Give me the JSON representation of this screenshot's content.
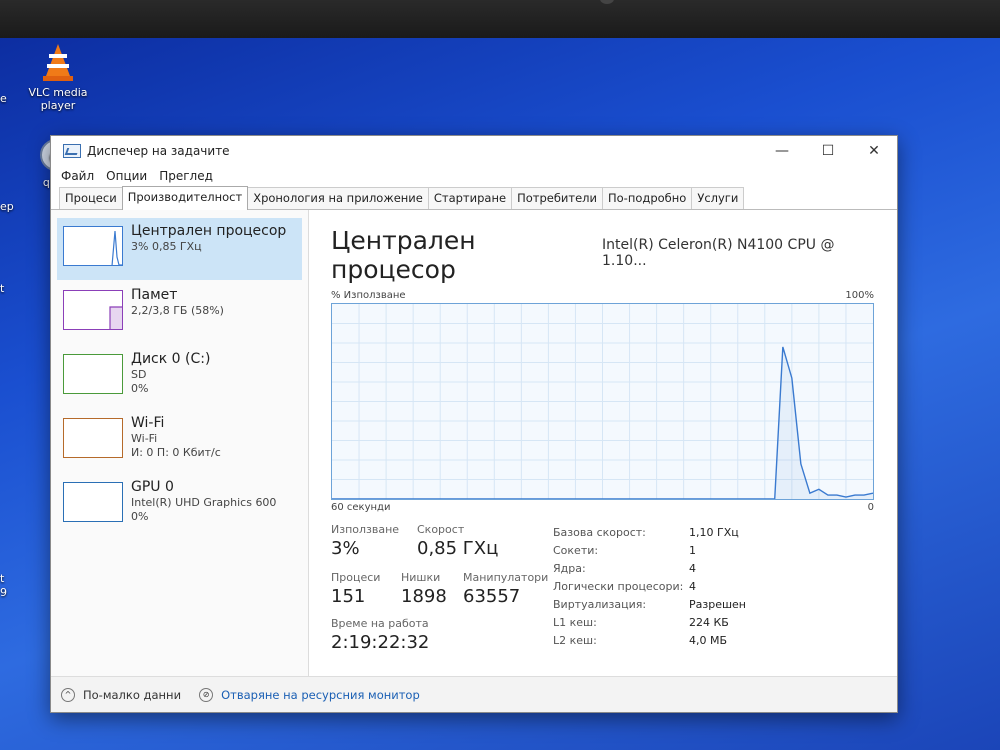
{
  "desktop": {
    "vlc_label": "VLC media player",
    "qbit_label": "qBitt",
    "left_fragments": [
      "е",
      "ер",
      "t",
      "t",
      "9"
    ]
  },
  "window": {
    "title": "Диспечер на задачите",
    "menu": [
      "Файл",
      "Опции",
      "Преглед"
    ],
    "tabs": [
      "Процеси",
      "Производителност",
      "Хронология на приложение",
      "Стартиране",
      "Потребители",
      "По-подробно",
      "Услуги"
    ],
    "active_tab": "Производителност"
  },
  "sidebar": {
    "items": [
      {
        "name": "Централен процесор",
        "sub1": "3% 0,85 ГХц",
        "sub2": ""
      },
      {
        "name": "Памет",
        "sub1": "2,2/3,8 ГБ (58%)",
        "sub2": ""
      },
      {
        "name": "Диск 0 (C:)",
        "sub1": "SD",
        "sub2": "0%"
      },
      {
        "name": "Wi-Fi",
        "sub1": "Wi-Fi",
        "sub2": "И: 0 П: 0 Кбит/с"
      },
      {
        "name": "GPU 0",
        "sub1": "Intel(R) UHD Graphics 600",
        "sub2": "0%"
      }
    ]
  },
  "main": {
    "title": "Централен процесор",
    "model": "Intel(R) Celeron(R) N4100 CPU @ 1.10...",
    "graph_ylabel": "% Използване",
    "graph_ymax": "100%",
    "graph_xlabel": "60 секунди",
    "graph_xmin": "0",
    "usage_label": "Използване",
    "usage_value": "3%",
    "speed_label": "Скорост",
    "speed_value": "0,85 ГХц",
    "processes_label": "Процеси",
    "processes_value": "151",
    "threads_label": "Нишки",
    "threads_value": "1898",
    "handles_label": "Манипулатори",
    "handles_value": "63557",
    "uptime_label": "Време на работа",
    "uptime_value": "2:19:22:32",
    "specs": [
      {
        "k": "Базова скорост:",
        "v": "1,10 ГХц"
      },
      {
        "k": "Сокети:",
        "v": "1"
      },
      {
        "k": "Ядра:",
        "v": "4"
      },
      {
        "k": "Логически процесори:",
        "v": "4"
      },
      {
        "k": "Виртуализация:",
        "v": "Разрешен"
      },
      {
        "k": "L1 кеш:",
        "v": "224 КБ"
      },
      {
        "k": "L2 кеш:",
        "v": "4,0 МБ"
      }
    ]
  },
  "footer": {
    "fewer_details": "По-малко данни",
    "resource_monitor": "Отваряне на ресурсния монитор"
  },
  "chart_data": {
    "type": "line",
    "x": [
      0,
      1,
      2,
      3,
      4,
      5,
      6,
      7,
      8,
      9,
      10,
      11,
      12,
      13,
      14,
      15,
      16,
      17,
      18,
      19,
      20,
      21,
      22,
      23,
      24,
      25,
      26,
      27,
      28,
      29,
      30,
      31,
      32,
      33,
      34,
      35,
      36,
      37,
      38,
      39,
      40,
      41,
      42,
      43,
      44,
      45,
      46,
      47,
      48,
      49,
      50,
      51,
      52,
      53,
      54,
      55,
      56,
      57,
      58,
      59,
      60
    ],
    "values": [
      0,
      0,
      0,
      0,
      0,
      0,
      0,
      0,
      0,
      0,
      0,
      0,
      0,
      0,
      0,
      0,
      0,
      0,
      0,
      0,
      0,
      0,
      0,
      0,
      0,
      0,
      0,
      0,
      0,
      0,
      0,
      0,
      0,
      0,
      0,
      0,
      0,
      0,
      0,
      0,
      0,
      0,
      0,
      0,
      0,
      0,
      0,
      0,
      0,
      0,
      0,
      0,
      0,
      0,
      0,
      0,
      0,
      0,
      0,
      0,
      0
    ],
    "points": [
      {
        "x": 0,
        "y": 0
      },
      {
        "x": 11,
        "y": 0
      },
      {
        "x": 12,
        "y": 78
      },
      {
        "x": 13,
        "y": 60
      },
      {
        "x": 14,
        "y": 18
      },
      {
        "x": 15,
        "y": 3
      },
      {
        "x": 16,
        "y": 5
      },
      {
        "x": 17,
        "y": 2
      },
      {
        "x": 18,
        "y": 2
      },
      {
        "x": 19,
        "y": 1
      },
      {
        "x": 20,
        "y": 2
      },
      {
        "x": 21,
        "y": 2
      },
      {
        "x": 22,
        "y": 2
      },
      {
        "x": 23,
        "y": 2
      },
      {
        "x": 24,
        "y": 3
      },
      {
        "x": 60,
        "y": 0
      }
    ],
    "x_reversed_seconds_ago": true,
    "xlabel": "60 секунди",
    "ylabel": "% Използване",
    "ylim": [
      0,
      100
    ],
    "grid": true,
    "color": "#3a7ad0"
  }
}
